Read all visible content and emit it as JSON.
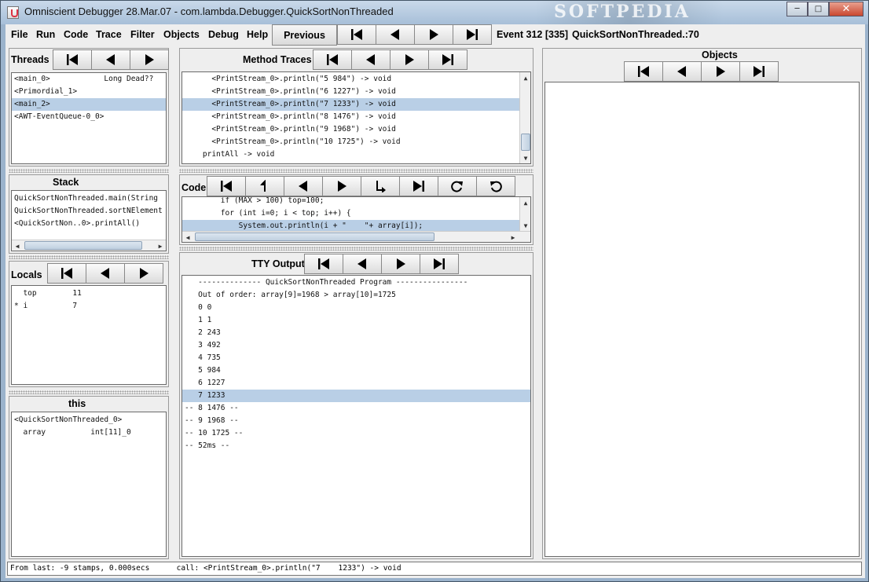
{
  "window": {
    "title": "Omniscient Debugger 28.Mar.07 - com.lambda.Debugger.QuickSortNonThreaded",
    "watermark": "SOFTPEDIA",
    "minimize_icon": "minimize-icon",
    "maximize_icon": "maximize-icon",
    "close_icon": "close-icon"
  },
  "menubar": {
    "items": [
      "File",
      "Run",
      "Code",
      "Trace",
      "Filter",
      "Objects",
      "Debug",
      "Help"
    ],
    "previous_label": "Previous",
    "event_label": "Event 312 [335]",
    "location_label": "QuickSortNonThreaded.:70"
  },
  "threads": {
    "title": "Threads",
    "rows": [
      "<main_0>            Long Dead??",
      "<Primordial_1>",
      "<main_2>",
      "<AWT-EventQueue-0_0>"
    ],
    "selected_index": 2
  },
  "method_traces": {
    "title": "Method Traces",
    "rows": [
      "      <PrintStream_0>.println(\"5 984\") -> void",
      "      <PrintStream_0>.println(\"6 1227\") -> void",
      "      <PrintStream_0>.println(\"7 1233\") -> void",
      "      <PrintStream_0>.println(\"8 1476\") -> void",
      "      <PrintStream_0>.println(\"9 1968\") -> void",
      "      <PrintStream_0>.println(\"10 1725\") -> void",
      "    printAll -> void"
    ],
    "selected_index": 2
  },
  "objects": {
    "title": "Objects"
  },
  "stack": {
    "title": "Stack",
    "rows": [
      "QuickSortNonThreaded.main(String",
      "QuickSortNonThreaded.sortNElement",
      "<QuickSortNon..0>.printAll()"
    ]
  },
  "code": {
    "title": "Code",
    "rows": [
      "        if (MAX > 100) top=100;",
      "        for (int i=0; i < top; i++) {",
      "            System.out.println(i + \"    \"+ array[i]);"
    ],
    "selected_index": 2
  },
  "locals": {
    "title": "Locals",
    "rows": [
      "  top        11",
      "* i          7"
    ]
  },
  "tty": {
    "title": "TTY Output",
    "rows": [
      "   -------------- QuickSortNonThreaded Program ----------------",
      "   Out of order: array[9]=1968 > array[10]=1725",
      "   0 0",
      "   1 1",
      "   2 243",
      "   3 492",
      "   4 735",
      "   5 984",
      "   6 1227",
      "   7 1233",
      "-- 8 1476 --",
      "-- 9 1968 --",
      "-- 10 1725 --",
      "-- 52ms --"
    ],
    "selected_index": 9
  },
  "this_panel": {
    "title": "this",
    "rows": [
      "<QuickSortNonThreaded_0>",
      "  array          int[11]_0"
    ]
  },
  "status": {
    "text": "From last: -9 stamps, 0.000secs      call: <PrintStream_0>.println(\"7    1233\") -> void"
  },
  "icons": {
    "first": "skip-to-first-icon",
    "back": "step-back-icon",
    "forward": "step-forward-icon",
    "last": "skip-to-last-icon",
    "step_out": "step-out-icon",
    "step_into": "step-into-icon",
    "redo": "redo-icon",
    "undo": "undo-icon"
  }
}
